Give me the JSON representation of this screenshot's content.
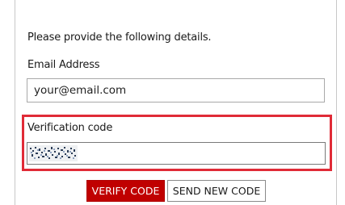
{
  "form": {
    "intro": "Please provide the following details.",
    "email": {
      "label": "Email Address",
      "value": "your@email.com"
    },
    "verification": {
      "label": "Verification code",
      "value": ""
    },
    "buttons": {
      "verify": "VERIFY CODE",
      "send_new": "SEND NEW CODE"
    }
  },
  "colors": {
    "highlight_border": "#e02b37",
    "primary_button": "#c00000"
  }
}
